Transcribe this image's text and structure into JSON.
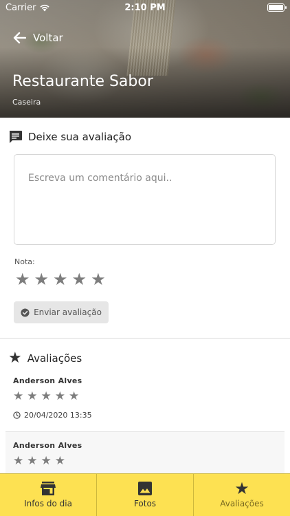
{
  "status_bar": {
    "carrier": "Carrier",
    "time": "2:10 PM"
  },
  "header": {
    "back_label": "Voltar",
    "title": "Restaurante Sabor",
    "subtitle": "Caseira"
  },
  "review_form": {
    "heading": "Deixe sua avaliação",
    "comment_placeholder": "Escreva um comentário aqui..",
    "rating_label": "Nota:",
    "rating_value": 0,
    "rating_max": 5,
    "submit_label": "Enviar avaliação"
  },
  "reviews_section": {
    "heading": "Avaliações",
    "items": [
      {
        "author": "Anderson Alves",
        "stars": 5,
        "date": "20/04/2020 13:35"
      },
      {
        "author": "Anderson Alves",
        "stars": 4
      }
    ]
  },
  "tab_bar": {
    "tabs": [
      {
        "label": "Infos do dia",
        "icon": "store-icon"
      },
      {
        "label": "Fotos",
        "icon": "image-icon"
      },
      {
        "label": "Avaliações",
        "icon": "star-icon",
        "active": true
      }
    ]
  },
  "colors": {
    "tab_bar_background": "#fde152",
    "star_color": "#7d7d7d"
  }
}
